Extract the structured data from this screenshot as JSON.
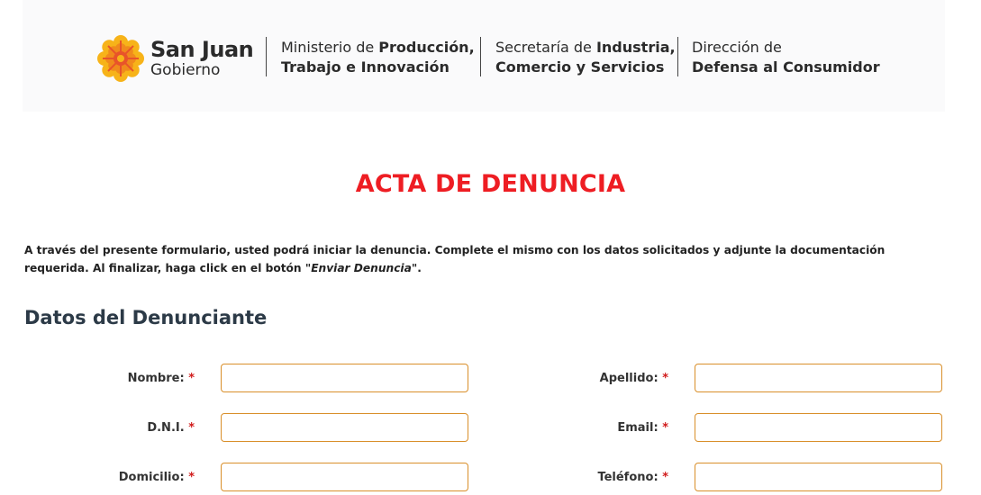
{
  "header": {
    "brand_title": "San Juan",
    "brand_subtitle": "Gobierno",
    "org1_line1_a": "Ministerio de ",
    "org1_line1_b": "Producción,",
    "org1_line2": "Trabajo e Innovación",
    "org2_line1_a": "Secretaría de ",
    "org2_line1_b": "Industria,",
    "org2_line2": "Comercio y Servicios",
    "org3_line1": "Dirección de",
    "org3_line2": "Defensa al Consumidor",
    "logo_colors": [
      "#f7b319",
      "#f08a1c",
      "#e8532a"
    ]
  },
  "page_title": "ACTA DE DENUNCIA",
  "intro": {
    "text": "A través del presente formulario, usted podrá iniciar la denuncia. Complete el mismo con los datos solicitados y adjunte la documentación requerida. Al finalizar, haga click en el botón ",
    "button_ref": "\"Enviar Denuncia\"",
    "end": "."
  },
  "section_title": "Datos del Denunciante",
  "required_mark": "*",
  "fields": {
    "nombre": {
      "label": "Nombre:",
      "value": ""
    },
    "apellido": {
      "label": "Apellido:",
      "value": ""
    },
    "dni": {
      "label": "D.N.I.",
      "value": ""
    },
    "email": {
      "label": "Email:",
      "value": ""
    },
    "domicilio": {
      "label": "Domicilio:",
      "value": ""
    },
    "telefono": {
      "label": "Teléfono:",
      "value": ""
    }
  },
  "colors": {
    "title_red": "#ee1d23",
    "input_border": "#d98f2a",
    "required_red": "#d11b1b"
  }
}
